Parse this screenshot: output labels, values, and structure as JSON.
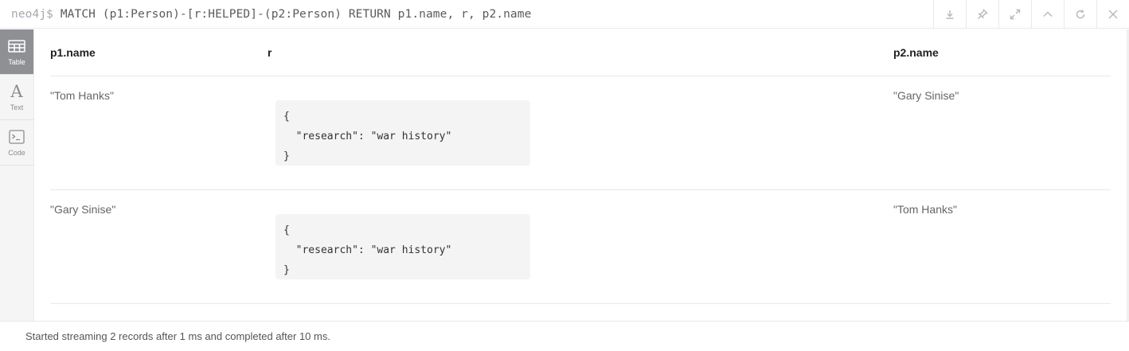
{
  "query": {
    "prompt": "neo4j$",
    "text": "MATCH (p1:Person)-[r:HELPED]-(p2:Person) RETURN p1.name, r, p2.name"
  },
  "header_actions": [
    {
      "icon": "download-icon"
    },
    {
      "icon": "pin-icon"
    },
    {
      "icon": "expand-icon"
    },
    {
      "icon": "collapse-icon"
    },
    {
      "icon": "rerun-icon"
    },
    {
      "icon": "close-icon"
    }
  ],
  "sidebar": {
    "tabs": [
      {
        "label": "Table",
        "icon": "table-icon",
        "active": true
      },
      {
        "label": "Text",
        "icon": "text-icon",
        "active": false
      },
      {
        "label": "Code",
        "icon": "code-icon",
        "active": false
      }
    ]
  },
  "table": {
    "columns": [
      "p1.name",
      "r",
      "p2.name"
    ],
    "rows": [
      {
        "p1": "\"Tom Hanks\"",
        "r": {
          "open": "{",
          "body": "  \"research\": \"war history\"",
          "close": "}"
        },
        "p2": "\"Gary Sinise\""
      },
      {
        "p1": "\"Gary Sinise\"",
        "r": {
          "open": "{",
          "body": "  \"research\": \"war history\"",
          "close": "}"
        },
        "p2": "\"Tom Hanks\""
      }
    ]
  },
  "footer": {
    "status": "Started streaming 2 records after 1 ms and completed after 10 ms."
  }
}
